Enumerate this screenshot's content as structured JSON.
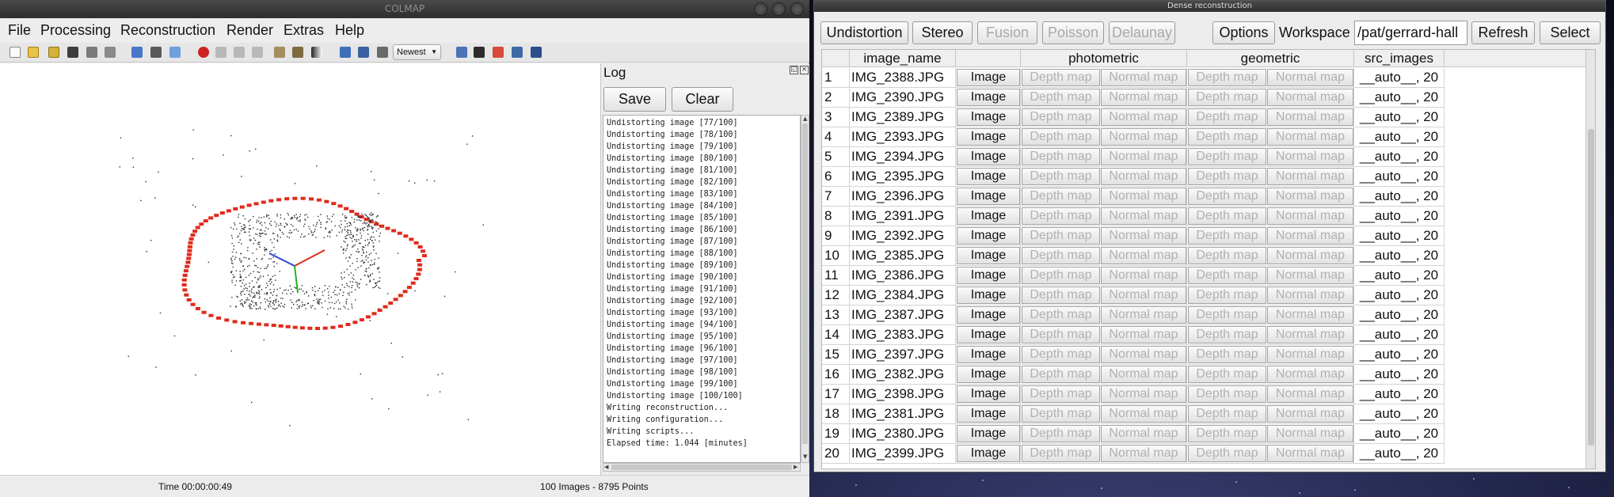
{
  "colmap": {
    "title": "COLMAP",
    "menu": [
      "File",
      "Processing",
      "Reconstruction",
      "Render",
      "Extras",
      "Help"
    ],
    "toolbar": {
      "sort_select": "Newest"
    },
    "log": {
      "title": "Log",
      "save_label": "Save",
      "clear_label": "Clear",
      "lines": [
        "Undistorting image [77/100]",
        "Undistorting image [78/100]",
        "Undistorting image [79/100]",
        "Undistorting image [80/100]",
        "Undistorting image [81/100]",
        "Undistorting image [82/100]",
        "Undistorting image [83/100]",
        "Undistorting image [84/100]",
        "Undistorting image [85/100]",
        "Undistorting image [86/100]",
        "Undistorting image [87/100]",
        "Undistorting image [88/100]",
        "Undistorting image [89/100]",
        "Undistorting image [90/100]",
        "Undistorting image [91/100]",
        "Undistorting image [92/100]",
        "Undistorting image [93/100]",
        "Undistorting image [94/100]",
        "Undistorting image [95/100]",
        "Undistorting image [96/100]",
        "Undistorting image [97/100]",
        "Undistorting image [98/100]",
        "Undistorting image [99/100]",
        "Undistorting image [100/100]",
        "Writing reconstruction...",
        "Writing configuration...",
        "Writing scripts...",
        "Elapsed time: 1.044 [minutes]"
      ]
    },
    "status": {
      "time": "Time 00:00:00:49",
      "counts": "100 Images - 8795 Points"
    },
    "colors": {
      "camera": "#e02a1c",
      "points": "#2b2b2b",
      "axis_x": "#e02a1c",
      "axis_y": "#22b422",
      "axis_z": "#2b45d8"
    }
  },
  "dense": {
    "title": "Dense reconstruction",
    "toolbar": {
      "undistortion": "Undistortion",
      "stereo": "Stereo",
      "fusion": "Fusion",
      "poisson": "Poisson",
      "delaunay": "Delaunay",
      "options": "Options",
      "workspace_label": "Workspace",
      "workspace_value": "/pat/gerrard-hall",
      "refresh": "Refresh",
      "select": "Select"
    },
    "table": {
      "headers": [
        "image_name",
        "photometric",
        "geometric",
        "src_images"
      ],
      "image_button": "Image",
      "depth_button": "Depth map",
      "normal_button": "Normal map",
      "rows": [
        {
          "idx": "1",
          "name": "IMG_2388.JPG",
          "src": "__auto__, 20"
        },
        {
          "idx": "2",
          "name": "IMG_2390.JPG",
          "src": "__auto__, 20"
        },
        {
          "idx": "3",
          "name": "IMG_2389.JPG",
          "src": "__auto__, 20"
        },
        {
          "idx": "4",
          "name": "IMG_2393.JPG",
          "src": "__auto__, 20"
        },
        {
          "idx": "5",
          "name": "IMG_2394.JPG",
          "src": "__auto__, 20"
        },
        {
          "idx": "6",
          "name": "IMG_2395.JPG",
          "src": "__auto__, 20"
        },
        {
          "idx": "7",
          "name": "IMG_2396.JPG",
          "src": "__auto__, 20"
        },
        {
          "idx": "8",
          "name": "IMG_2391.JPG",
          "src": "__auto__, 20"
        },
        {
          "idx": "9",
          "name": "IMG_2392.JPG",
          "src": "__auto__, 20"
        },
        {
          "idx": "10",
          "name": "IMG_2385.JPG",
          "src": "__auto__, 20"
        },
        {
          "idx": "11",
          "name": "IMG_2386.JPG",
          "src": "__auto__, 20"
        },
        {
          "idx": "12",
          "name": "IMG_2384.JPG",
          "src": "__auto__, 20"
        },
        {
          "idx": "13",
          "name": "IMG_2387.JPG",
          "src": "__auto__, 20"
        },
        {
          "idx": "14",
          "name": "IMG_2383.JPG",
          "src": "__auto__, 20"
        },
        {
          "idx": "15",
          "name": "IMG_2397.JPG",
          "src": "__auto__, 20"
        },
        {
          "idx": "16",
          "name": "IMG_2382.JPG",
          "src": "__auto__, 20"
        },
        {
          "idx": "17",
          "name": "IMG_2398.JPG",
          "src": "__auto__, 20"
        },
        {
          "idx": "18",
          "name": "IMG_2381.JPG",
          "src": "__auto__, 20"
        },
        {
          "idx": "19",
          "name": "IMG_2380.JPG",
          "src": "__auto__, 20"
        },
        {
          "idx": "20",
          "name": "IMG_2399.JPG",
          "src": "__auto__, 20"
        }
      ]
    }
  }
}
